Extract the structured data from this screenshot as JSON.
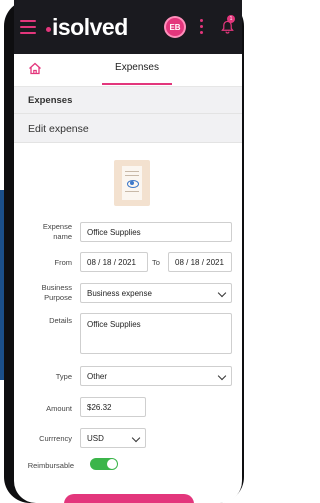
{
  "app": {
    "logo_text": "isolved",
    "avatar_initials": "EB",
    "notification_count": "1"
  },
  "tabs": {
    "active_label": "Expenses"
  },
  "section": {
    "label": "Expenses"
  },
  "card": {
    "title": "Edit expense"
  },
  "form": {
    "expense_name_label": "Expense name",
    "expense_name_value": "Office Supplies",
    "from_label": "From",
    "from_value": "08 / 18 / 2021",
    "to_label": "To",
    "to_value": "08 / 18 / 2021",
    "business_purpose_label": "Business Purpose",
    "business_purpose_value": "Business expense",
    "details_label": "Details",
    "details_value": "Office Supplies",
    "type_label": "Type",
    "type_value": "Other",
    "amount_label": "Amount",
    "amount_value": "$26.32",
    "currency_label": "Currrency",
    "currency_value": "USD",
    "reimbursable_label": "Reimbursable",
    "reimbursable_on": true
  },
  "colors": {
    "brand_pink": "#e3367c",
    "toggle_green": "#3bb54a",
    "appbar_dark": "#1a1a1f"
  },
  "icons": [
    "hamburger-icon",
    "avatar",
    "kebab-menu-icon",
    "bell-icon",
    "home-icon",
    "receipt-icon",
    "chevron-down-icon",
    "toggle-switch"
  ]
}
